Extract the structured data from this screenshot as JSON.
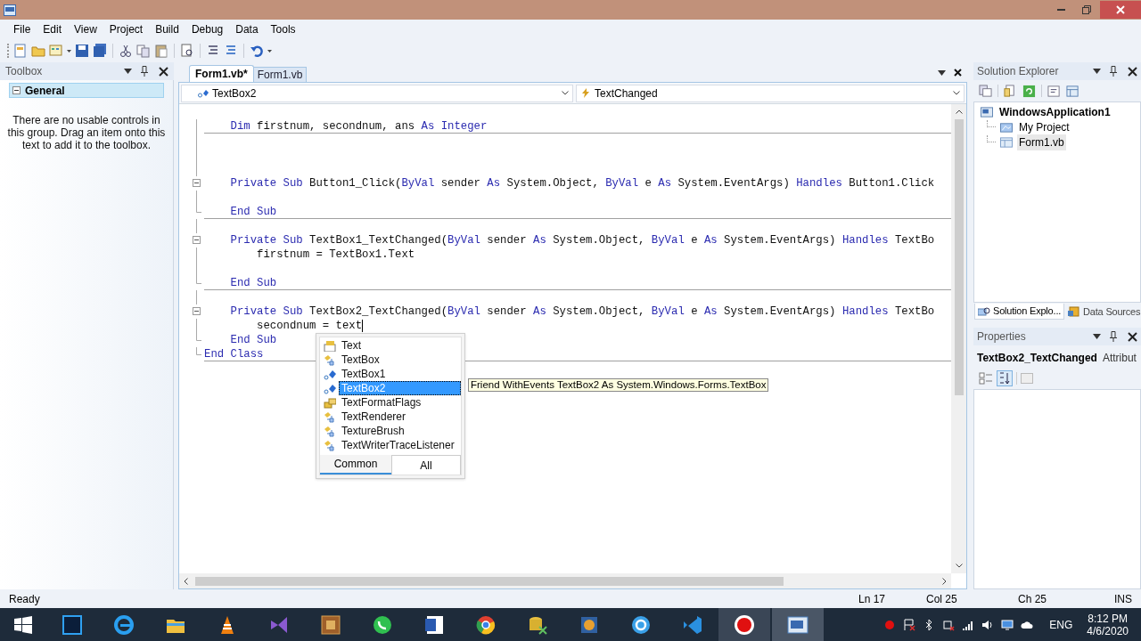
{
  "menu": [
    "File",
    "Edit",
    "View",
    "Project",
    "Build",
    "Debug",
    "Data",
    "Tools"
  ],
  "toolbox": {
    "title": "Toolbox",
    "group": {
      "label": "General",
      "expanded": true
    },
    "message": "There are no usable controls in this group. Drag an item onto this text to add it to the toolbox."
  },
  "editor": {
    "tabs": [
      {
        "label": "Form1.vb*",
        "selected": true
      },
      {
        "label": "Form1.vb",
        "selected": false
      }
    ],
    "object_dropdown": "TextBox2",
    "event_dropdown": "TextChanged",
    "lines": [
      {
        "kind": "blank",
        "collapsible": false,
        "block_end": false,
        "divider_below": false,
        "caret": false
      },
      {
        "kind": "code",
        "collapsible": false,
        "block_end": false,
        "divider_below": true,
        "caret": false,
        "tokens": [
          {
            "text": "    Dim",
            "kind": "keyword"
          },
          {
            "text": " firstnum, secondnum, ans ",
            "kind": "plain"
          },
          {
            "text": "As Integer",
            "kind": "keyword"
          }
        ]
      },
      {
        "kind": "blank",
        "collapsible": false,
        "block_end": false,
        "divider_below": false,
        "caret": false
      },
      {
        "kind": "blank",
        "collapsible": false,
        "block_end": false,
        "divider_below": false,
        "caret": false
      },
      {
        "kind": "blank",
        "collapsible": false,
        "block_end": false,
        "divider_below": false,
        "caret": false
      },
      {
        "kind": "code",
        "collapsible": true,
        "block_end": false,
        "divider_below": false,
        "caret": false,
        "tokens": [
          {
            "text": "    Private Sub",
            "kind": "keyword"
          },
          {
            "text": " Button1_Click(",
            "kind": "plain"
          },
          {
            "text": "ByVal",
            "kind": "keyword"
          },
          {
            "text": " sender ",
            "kind": "plain"
          },
          {
            "text": "As",
            "kind": "keyword"
          },
          {
            "text": " System.Object, ",
            "kind": "plain"
          },
          {
            "text": "ByVal",
            "kind": "keyword"
          },
          {
            "text": " e ",
            "kind": "plain"
          },
          {
            "text": "As",
            "kind": "keyword"
          },
          {
            "text": " System.EventArgs) ",
            "kind": "plain"
          },
          {
            "text": "Handles",
            "kind": "keyword"
          },
          {
            "text": " Button1.Click",
            "kind": "plain"
          }
        ]
      },
      {
        "kind": "blank",
        "collapsible": false,
        "block_end": false,
        "divider_below": false,
        "caret": false
      },
      {
        "kind": "code",
        "collapsible": false,
        "block_end": true,
        "divider_below": true,
        "caret": false,
        "tokens": [
          {
            "text": "    End Sub",
            "kind": "keyword"
          }
        ]
      },
      {
        "kind": "blank",
        "collapsible": false,
        "block_end": false,
        "divider_below": false,
        "caret": false
      },
      {
        "kind": "code",
        "collapsible": true,
        "block_end": false,
        "divider_below": false,
        "caret": false,
        "tokens": [
          {
            "text": "    Private Sub",
            "kind": "keyword"
          },
          {
            "text": " TextBox1_TextChanged(",
            "kind": "plain"
          },
          {
            "text": "ByVal",
            "kind": "keyword"
          },
          {
            "text": " sender ",
            "kind": "plain"
          },
          {
            "text": "As",
            "kind": "keyword"
          },
          {
            "text": " System.Object, ",
            "kind": "plain"
          },
          {
            "text": "ByVal",
            "kind": "keyword"
          },
          {
            "text": " e ",
            "kind": "plain"
          },
          {
            "text": "As",
            "kind": "keyword"
          },
          {
            "text": " System.EventArgs) ",
            "kind": "plain"
          },
          {
            "text": "Handles",
            "kind": "keyword"
          },
          {
            "text": " TextBo",
            "kind": "plain"
          }
        ]
      },
      {
        "kind": "code",
        "collapsible": false,
        "block_end": false,
        "divider_below": false,
        "caret": false,
        "tokens": [
          {
            "text": "        firstnum = TextBox1.Text",
            "kind": "plain"
          }
        ]
      },
      {
        "kind": "blank",
        "collapsible": false,
        "block_end": false,
        "divider_below": false,
        "caret": false
      },
      {
        "kind": "code",
        "collapsible": false,
        "block_end": true,
        "divider_below": true,
        "caret": false,
        "tokens": [
          {
            "text": "    End Sub",
            "kind": "keyword"
          }
        ]
      },
      {
        "kind": "blank",
        "collapsible": false,
        "block_end": false,
        "divider_below": false,
        "caret": false
      },
      {
        "kind": "code",
        "collapsible": true,
        "block_end": false,
        "divider_below": false,
        "caret": false,
        "tokens": [
          {
            "text": "    Private Sub",
            "kind": "keyword"
          },
          {
            "text": " TextBox2_TextChanged(",
            "kind": "plain"
          },
          {
            "text": "ByVal",
            "kind": "keyword"
          },
          {
            "text": " sender ",
            "kind": "plain"
          },
          {
            "text": "As",
            "kind": "keyword"
          },
          {
            "text": " System.Object, ",
            "kind": "plain"
          },
          {
            "text": "ByVal",
            "kind": "keyword"
          },
          {
            "text": " e ",
            "kind": "plain"
          },
          {
            "text": "As",
            "kind": "keyword"
          },
          {
            "text": " System.EventArgs) ",
            "kind": "plain"
          },
          {
            "text": "Handles",
            "kind": "keyword"
          },
          {
            "text": " TextBo",
            "kind": "plain"
          }
        ]
      },
      {
        "kind": "code",
        "collapsible": false,
        "block_end": false,
        "divider_below": false,
        "caret": true,
        "tokens": [
          {
            "text": "        secondnum = text",
            "kind": "plain"
          }
        ]
      },
      {
        "kind": "code",
        "collapsible": false,
        "block_end": true,
        "divider_below": false,
        "caret": false,
        "tokens": [
          {
            "text": "    End Sub",
            "kind": "keyword"
          }
        ]
      },
      {
        "kind": "code",
        "collapsible": false,
        "block_end": true,
        "divider_below": true,
        "caret": false,
        "tokens": [
          {
            "text": "End Class",
            "kind": "keyword"
          }
        ]
      }
    ],
    "completion": {
      "items": [
        {
          "label": "Text",
          "kind": "property",
          "selected": false
        },
        {
          "label": "TextBox",
          "kind": "class",
          "selected": false
        },
        {
          "label": "TextBox1",
          "kind": "field",
          "selected": false
        },
        {
          "label": "TextBox2",
          "kind": "field",
          "selected": true
        },
        {
          "label": "TextFormatFlags",
          "kind": "enum",
          "selected": false
        },
        {
          "label": "TextRenderer",
          "kind": "class",
          "selected": false
        },
        {
          "label": "TextureBrush",
          "kind": "class",
          "selected": false
        },
        {
          "label": "TextWriterTraceListener",
          "kind": "class",
          "selected": false
        }
      ],
      "tabs": [
        {
          "label": "Common",
          "selected": true
        },
        {
          "label": "All",
          "selected": false
        }
      ],
      "tooltip": "Friend WithEvents TextBox2 As System.Windows.Forms.TextBox"
    }
  },
  "solution_explorer": {
    "title": "Solution Explorer",
    "tree": [
      {
        "label": "WindowsApplication1",
        "kind": "project",
        "children": [
          {
            "label": "My Project",
            "kind": "settings",
            "selected": false
          },
          {
            "label": "Form1.vb",
            "kind": "form",
            "selected": true
          }
        ]
      }
    ],
    "tabs": [
      {
        "label": "Solution Explo...",
        "selected": true
      },
      {
        "label": "Data Sources",
        "selected": false
      }
    ]
  },
  "properties": {
    "title": "Properties",
    "object": "TextBox2_TextChanged",
    "object_type": "Attribut"
  },
  "status_bar": {
    "text": "Ready",
    "line": "Ln 17",
    "col": "Col 25",
    "ch": "Ch 25",
    "mode": "INS"
  },
  "taskbar": {
    "language": "ENG",
    "time": "8:12 PM",
    "date": "4/6/2020"
  }
}
